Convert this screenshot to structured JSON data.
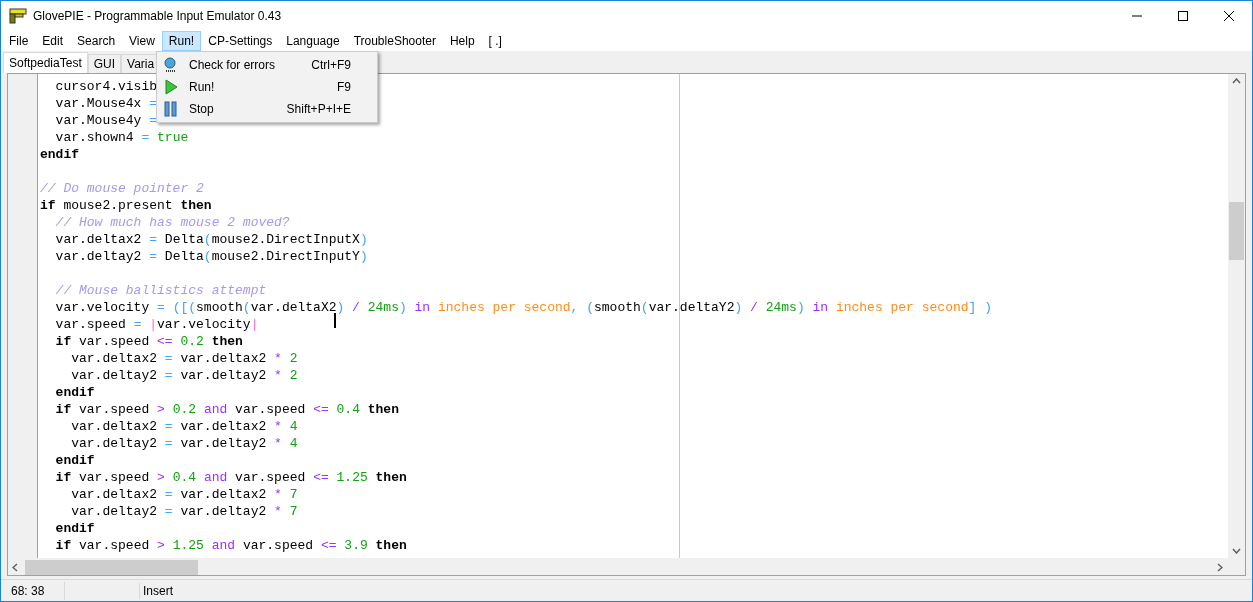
{
  "window": {
    "title": "GlovePIE - Programmable Input Emulator 0.43"
  },
  "menu_bar": [
    {
      "label": "File",
      "selected": false
    },
    {
      "label": "Edit",
      "selected": false
    },
    {
      "label": "Search",
      "selected": false
    },
    {
      "label": "View",
      "selected": false
    },
    {
      "label": "Run!",
      "selected": true
    },
    {
      "label": "CP-Settings",
      "selected": false
    },
    {
      "label": "Language",
      "selected": false
    },
    {
      "label": "TroubleShooter",
      "selected": false
    },
    {
      "label": "Help",
      "selected": false
    },
    {
      "label": "[ .]",
      "selected": false
    }
  ],
  "tabs": [
    {
      "label": "SoftpediaTest",
      "selected": true
    },
    {
      "label": "GUI",
      "selected": false
    },
    {
      "label": "Varia",
      "selected": false
    }
  ],
  "run_menu": [
    {
      "kind": "check",
      "label": "Check for errors",
      "shortcut": "Ctrl+F9"
    },
    {
      "kind": "run",
      "label": "Run!",
      "shortcut": "F9"
    },
    {
      "kind": "stop",
      "label": "Stop",
      "shortcut": "Shift+P+I+E"
    }
  ],
  "code_lines": [
    {
      "kind": "code",
      "tokens": [
        {
          "kind": "plain",
          "text": "  cursor4.visib"
        }
      ]
    },
    {
      "kind": "code",
      "tokens": [
        {
          "kind": "plain",
          "text": "  var.Mouse4x "
        },
        {
          "kind": "op",
          "text": "="
        }
      ]
    },
    {
      "kind": "code",
      "tokens": [
        {
          "kind": "plain",
          "text": "  var.Mouse4y "
        },
        {
          "kind": "op",
          "text": "="
        }
      ]
    },
    {
      "kind": "code",
      "tokens": [
        {
          "kind": "plain",
          "text": "  var.shown4 "
        },
        {
          "kind": "op",
          "text": "="
        },
        {
          "kind": "num",
          "text": " true"
        }
      ]
    },
    {
      "kind": "code",
      "tokens": [
        {
          "kind": "kw",
          "text": "endif"
        }
      ]
    },
    {
      "kind": "blank"
    },
    {
      "kind": "code",
      "tokens": [
        {
          "kind": "comment",
          "text": "// Do mouse pointer 2"
        }
      ]
    },
    {
      "kind": "code",
      "tokens": [
        {
          "kind": "kw",
          "text": "if"
        },
        {
          "kind": "plain",
          "text": " mouse2.present "
        },
        {
          "kind": "kw",
          "text": "then"
        }
      ]
    },
    {
      "kind": "code",
      "tokens": [
        {
          "kind": "comment",
          "text": "  // How much has mouse 2 moved?"
        }
      ]
    },
    {
      "kind": "code",
      "tokens": [
        {
          "kind": "plain",
          "text": "  var.deltax2 "
        },
        {
          "kind": "op",
          "text": "="
        },
        {
          "kind": "plain",
          "text": " Delta"
        },
        {
          "kind": "op",
          "text": "("
        },
        {
          "kind": "plain",
          "text": "mouse2.DirectInputX"
        },
        {
          "kind": "op",
          "text": ")"
        }
      ]
    },
    {
      "kind": "code",
      "tokens": [
        {
          "kind": "plain",
          "text": "  var.deltay2 "
        },
        {
          "kind": "op",
          "text": "="
        },
        {
          "kind": "plain",
          "text": " Delta"
        },
        {
          "kind": "op",
          "text": "("
        },
        {
          "kind": "plain",
          "text": "mouse2.DirectInputY"
        },
        {
          "kind": "op",
          "text": ")"
        }
      ]
    },
    {
      "kind": "blank"
    },
    {
      "kind": "code",
      "tokens": [
        {
          "kind": "comment",
          "text": "  // Mouse ballistics attempt"
        }
      ]
    },
    {
      "kind": "code",
      "tokens": [
        {
          "kind": "plain",
          "text": "  var.velocity "
        },
        {
          "kind": "op",
          "text": "= ([("
        },
        {
          "kind": "plain",
          "text": "smooth"
        },
        {
          "kind": "op",
          "text": "("
        },
        {
          "kind": "plain",
          "text": "var.deltaX2"
        },
        {
          "kind": "op",
          "text": ")"
        },
        {
          "kind": "purple",
          "text": " /"
        },
        {
          "kind": "num",
          "text": " 24ms"
        },
        {
          "kind": "op",
          "text": ")"
        },
        {
          "kind": "purple",
          "text": " in"
        },
        {
          "kind": "unit",
          "text": " inches per second"
        },
        {
          "kind": "op",
          "text": ", ("
        },
        {
          "kind": "plain",
          "text": "smooth"
        },
        {
          "kind": "op",
          "text": "("
        },
        {
          "kind": "plain",
          "text": "var.deltaY2"
        },
        {
          "kind": "op",
          "text": ")"
        },
        {
          "kind": "purple",
          "text": " /"
        },
        {
          "kind": "num",
          "text": " 24ms"
        },
        {
          "kind": "op",
          "text": ")"
        },
        {
          "kind": "purple",
          "text": " in"
        },
        {
          "kind": "unit",
          "text": " inches per second"
        },
        {
          "kind": "op",
          "text": "] )"
        }
      ]
    },
    {
      "kind": "code",
      "tokens": [
        {
          "kind": "plain",
          "text": "  var.speed "
        },
        {
          "kind": "op",
          "text": "="
        },
        {
          "kind": "pipe",
          "text": " |"
        },
        {
          "kind": "plain",
          "text": "var.velocity"
        },
        {
          "kind": "pipe",
          "text": "|"
        }
      ]
    },
    {
      "kind": "code",
      "tokens": [
        {
          "kind": "kw",
          "text": "  if"
        },
        {
          "kind": "plain",
          "text": " var.speed "
        },
        {
          "kind": "purple",
          "text": "<="
        },
        {
          "kind": "num",
          "text": " 0.2"
        },
        {
          "kind": "kw",
          "text": " then"
        }
      ]
    },
    {
      "kind": "code",
      "tokens": [
        {
          "kind": "plain",
          "text": "    var.deltax2 "
        },
        {
          "kind": "op",
          "text": "="
        },
        {
          "kind": "plain",
          "text": " var.deltax2 "
        },
        {
          "kind": "purple",
          "text": "*"
        },
        {
          "kind": "num",
          "text": " 2"
        }
      ]
    },
    {
      "kind": "code",
      "tokens": [
        {
          "kind": "plain",
          "text": "    var.deltay2 "
        },
        {
          "kind": "op",
          "text": "="
        },
        {
          "kind": "plain",
          "text": " var.deltay2 "
        },
        {
          "kind": "purple",
          "text": "*"
        },
        {
          "kind": "num",
          "text": " 2"
        }
      ]
    },
    {
      "kind": "code",
      "tokens": [
        {
          "kind": "kw",
          "text": "  endif"
        }
      ]
    },
    {
      "kind": "code",
      "tokens": [
        {
          "kind": "kw",
          "text": "  if"
        },
        {
          "kind": "plain",
          "text": " var.speed "
        },
        {
          "kind": "purple",
          "text": ">"
        },
        {
          "kind": "num",
          "text": " 0.2"
        },
        {
          "kind": "purple",
          "text": " and"
        },
        {
          "kind": "plain",
          "text": " var.speed "
        },
        {
          "kind": "purple",
          "text": "<="
        },
        {
          "kind": "num",
          "text": " 0.4"
        },
        {
          "kind": "kw",
          "text": " then"
        }
      ]
    },
    {
      "kind": "code",
      "tokens": [
        {
          "kind": "plain",
          "text": "    var.deltax2 "
        },
        {
          "kind": "op",
          "text": "="
        },
        {
          "kind": "plain",
          "text": " var.deltax2 "
        },
        {
          "kind": "purple",
          "text": "*"
        },
        {
          "kind": "num",
          "text": " 4"
        }
      ]
    },
    {
      "kind": "code",
      "tokens": [
        {
          "kind": "plain",
          "text": "    var.deltay2 "
        },
        {
          "kind": "op",
          "text": "="
        },
        {
          "kind": "plain",
          "text": " var.deltay2 "
        },
        {
          "kind": "purple",
          "text": "*"
        },
        {
          "kind": "num",
          "text": " 4"
        }
      ]
    },
    {
      "kind": "code",
      "tokens": [
        {
          "kind": "kw",
          "text": "  endif"
        }
      ]
    },
    {
      "kind": "code",
      "tokens": [
        {
          "kind": "kw",
          "text": "  if"
        },
        {
          "kind": "plain",
          "text": " var.speed "
        },
        {
          "kind": "purple",
          "text": ">"
        },
        {
          "kind": "num",
          "text": " 0.4"
        },
        {
          "kind": "purple",
          "text": " and"
        },
        {
          "kind": "plain",
          "text": " var.speed "
        },
        {
          "kind": "purple",
          "text": "<="
        },
        {
          "kind": "num",
          "text": " 1.25"
        },
        {
          "kind": "kw",
          "text": " then"
        }
      ]
    },
    {
      "kind": "code",
      "tokens": [
        {
          "kind": "plain",
          "text": "    var.deltax2 "
        },
        {
          "kind": "op",
          "text": "="
        },
        {
          "kind": "plain",
          "text": " var.deltax2 "
        },
        {
          "kind": "purple",
          "text": "*"
        },
        {
          "kind": "num",
          "text": " 7"
        }
      ]
    },
    {
      "kind": "code",
      "tokens": [
        {
          "kind": "plain",
          "text": "    var.deltay2 "
        },
        {
          "kind": "op",
          "text": "="
        },
        {
          "kind": "plain",
          "text": " var.deltay2 "
        },
        {
          "kind": "purple",
          "text": "*"
        },
        {
          "kind": "num",
          "text": " 7"
        }
      ]
    },
    {
      "kind": "code",
      "tokens": [
        {
          "kind": "kw",
          "text": "  endif"
        }
      ]
    },
    {
      "kind": "code",
      "tokens": [
        {
          "kind": "kw",
          "text": "  if"
        },
        {
          "kind": "plain",
          "text": " var.speed "
        },
        {
          "kind": "purple",
          "text": ">"
        },
        {
          "kind": "num",
          "text": " 1.25"
        },
        {
          "kind": "purple",
          "text": " and"
        },
        {
          "kind": "plain",
          "text": " var.speed "
        },
        {
          "kind": "purple",
          "text": "<="
        },
        {
          "kind": "num",
          "text": " 3.9"
        },
        {
          "kind": "kw",
          "text": " then"
        }
      ]
    }
  ],
  "status_bar": {
    "position": "68: 38",
    "mode": "Insert"
  }
}
